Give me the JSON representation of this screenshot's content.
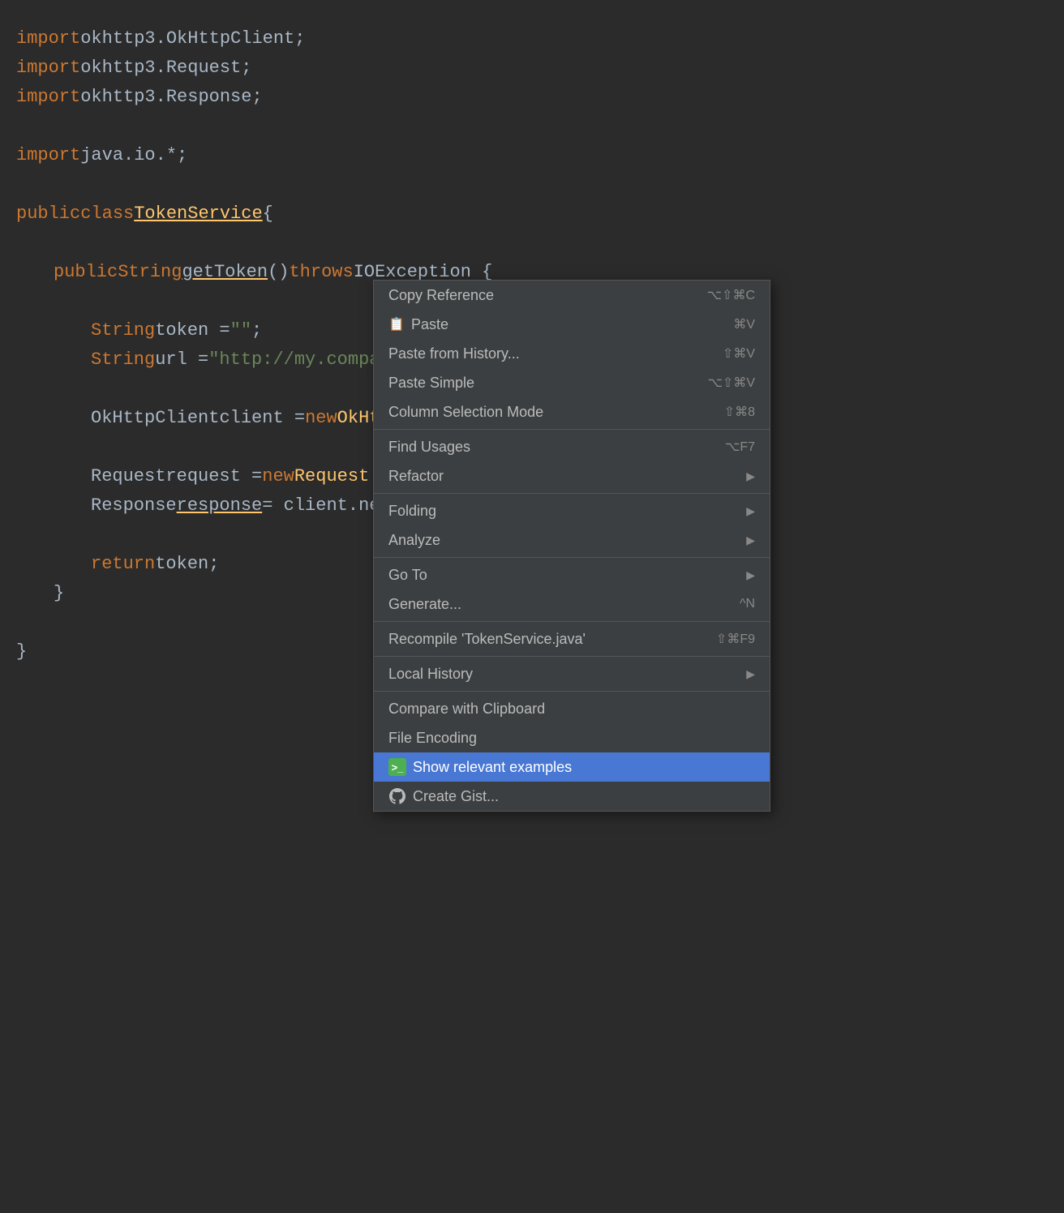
{
  "editor": {
    "background": "#2b2b2b",
    "lines": [
      {
        "id": 1,
        "tokens": [
          {
            "text": "import ",
            "class": "kw-import"
          },
          {
            "text": "okhttp3.OkHttpClient",
            "class": "identifier"
          },
          {
            "text": ";",
            "class": "punctuation"
          }
        ]
      },
      {
        "id": 2,
        "tokens": [
          {
            "text": "import ",
            "class": "kw-import"
          },
          {
            "text": "okhttp3.Request",
            "class": "identifier"
          },
          {
            "text": ";",
            "class": "punctuation"
          }
        ]
      },
      {
        "id": 3,
        "tokens": [
          {
            "text": "import ",
            "class": "kw-import"
          },
          {
            "text": "okhttp3.Response",
            "class": "identifier"
          },
          {
            "text": ";",
            "class": "punctuation"
          }
        ]
      },
      {
        "id": 4,
        "tokens": []
      },
      {
        "id": 5,
        "tokens": [
          {
            "text": "import ",
            "class": "kw-import"
          },
          {
            "text": "java.io.*",
            "class": "identifier"
          },
          {
            "text": ";",
            "class": "punctuation"
          }
        ]
      },
      {
        "id": 6,
        "tokens": []
      },
      {
        "id": 7,
        "tokens": [
          {
            "text": "public ",
            "class": "kw-public"
          },
          {
            "text": "class ",
            "class": "kw-class-kw"
          },
          {
            "text": "TokenService",
            "class": "class-name underline"
          },
          {
            "text": " {",
            "class": "punctuation"
          }
        ]
      },
      {
        "id": 8,
        "tokens": []
      },
      {
        "id": 9,
        "indent": 1,
        "tokens": [
          {
            "text": "public ",
            "class": "kw-public"
          },
          {
            "text": "String ",
            "class": "kw-string-type"
          },
          {
            "text": "getToken",
            "class": "identifier underline"
          },
          {
            "text": "() ",
            "class": "punctuation"
          },
          {
            "text": "throws ",
            "class": "kw-throws"
          },
          {
            "text": "IOException {",
            "class": "identifier"
          }
        ]
      },
      {
        "id": 10,
        "tokens": []
      },
      {
        "id": 11,
        "indent": 2,
        "tokens": [
          {
            "text": "String ",
            "class": "kw-string-type"
          },
          {
            "text": "token = ",
            "class": "identifier"
          },
          {
            "text": "\"\"",
            "class": "string-val"
          },
          {
            "text": ";",
            "class": "punctuation"
          }
        ]
      },
      {
        "id": 12,
        "indent": 2,
        "tokens": [
          {
            "text": "String ",
            "class": "kw-string-type"
          },
          {
            "text": "url = ",
            "class": "identifier"
          },
          {
            "text": "\"http://my.company.com/api/token\"",
            "class": "string-val"
          },
          {
            "text": ";",
            "class": "punctuation"
          }
        ]
      },
      {
        "id": 13,
        "tokens": []
      },
      {
        "id": 14,
        "indent": 2,
        "tokens": [
          {
            "text": "OkHttpClient ",
            "class": "identifier"
          },
          {
            "text": "client = ",
            "class": "identifier"
          },
          {
            "text": "new ",
            "class": "kw-new"
          },
          {
            "text": "OkHttpCl...()",
            "class": "class-name"
          }
        ]
      },
      {
        "id": 15,
        "tokens": []
      },
      {
        "id": 16,
        "indent": 2,
        "tokens": [
          {
            "text": "Request ",
            "class": "identifier"
          },
          {
            "text": "request = ",
            "class": "identifier"
          },
          {
            "text": "new ",
            "class": "kw-new"
          },
          {
            "text": "Request.Bui...",
            "class": "class-name"
          }
        ]
      },
      {
        "id": 17,
        "indent": 2,
        "tokens": [
          {
            "text": "Response ",
            "class": "identifier"
          },
          {
            "text": "response",
            "class": "identifier underline"
          },
          {
            "text": " = client.newCal...",
            "class": "identifier"
          }
        ]
      },
      {
        "id": 18,
        "tokens": []
      },
      {
        "id": 19,
        "indent": 2,
        "tokens": [
          {
            "text": "return ",
            "class": "kw-return"
          },
          {
            "text": "token;",
            "class": "identifier"
          }
        ]
      },
      {
        "id": 20,
        "indent": 1,
        "tokens": [
          {
            "text": "}",
            "class": "punctuation"
          }
        ]
      },
      {
        "id": 21,
        "tokens": []
      },
      {
        "id": 22,
        "tokens": [
          {
            "text": "}",
            "class": "punctuation"
          }
        ]
      }
    ]
  },
  "contextMenu": {
    "items": [
      {
        "id": "copy-reference",
        "label": "Copy Reference",
        "shortcut": "⌥⇧⌘C",
        "hasSubmenu": false,
        "icon": null,
        "group": 1
      },
      {
        "id": "paste",
        "label": "Paste",
        "shortcut": "⌘V",
        "hasSubmenu": false,
        "icon": "paste",
        "group": 1
      },
      {
        "id": "paste-from-history",
        "label": "Paste from History...",
        "shortcut": "⇧⌘V",
        "hasSubmenu": false,
        "icon": null,
        "group": 1
      },
      {
        "id": "paste-simple",
        "label": "Paste Simple",
        "shortcut": "⌥⇧⌘V",
        "hasSubmenu": false,
        "icon": null,
        "group": 1
      },
      {
        "id": "column-selection",
        "label": "Column Selection Mode",
        "shortcut": "⇧⌘8",
        "hasSubmenu": false,
        "icon": null,
        "group": 1
      },
      {
        "id": "find-usages",
        "label": "Find Usages",
        "shortcut": "⌥F7",
        "hasSubmenu": false,
        "icon": null,
        "group": 2
      },
      {
        "id": "refactor",
        "label": "Refactor",
        "shortcut": "",
        "hasSubmenu": true,
        "icon": null,
        "group": 2
      },
      {
        "id": "folding",
        "label": "Folding",
        "shortcut": "",
        "hasSubmenu": true,
        "icon": null,
        "group": 3
      },
      {
        "id": "analyze",
        "label": "Analyze",
        "shortcut": "",
        "hasSubmenu": true,
        "icon": null,
        "group": 3
      },
      {
        "id": "goto",
        "label": "Go To",
        "shortcut": "",
        "hasSubmenu": true,
        "icon": null,
        "group": 4
      },
      {
        "id": "generate",
        "label": "Generate...",
        "shortcut": "^N",
        "hasSubmenu": false,
        "icon": null,
        "group": 4
      },
      {
        "id": "recompile",
        "label": "Recompile 'TokenService.java'",
        "shortcut": "⇧⌘F9",
        "hasSubmenu": false,
        "icon": null,
        "group": 5
      },
      {
        "id": "local-history",
        "label": "Local History",
        "shortcut": "",
        "hasSubmenu": true,
        "icon": null,
        "group": 6
      },
      {
        "id": "compare-clipboard",
        "label": "Compare with Clipboard",
        "shortcut": "",
        "hasSubmenu": false,
        "icon": null,
        "group": 7
      },
      {
        "id": "file-encoding",
        "label": "File Encoding",
        "shortcut": "",
        "hasSubmenu": false,
        "icon": null,
        "group": 7
      },
      {
        "id": "show-examples",
        "label": "Show relevant examples",
        "shortcut": "",
        "hasSubmenu": false,
        "icon": "green-terminal",
        "group": 8,
        "highlighted": true
      },
      {
        "id": "create-gist",
        "label": "Create Gist...",
        "shortcut": "",
        "hasSubmenu": false,
        "icon": "github",
        "group": 8
      }
    ]
  }
}
